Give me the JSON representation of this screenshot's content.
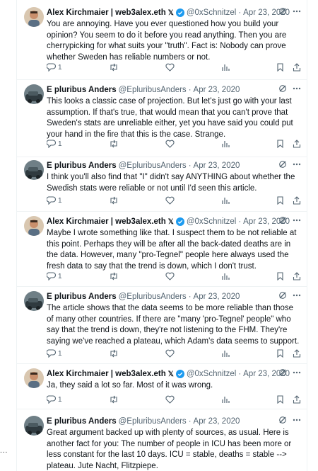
{
  "tweets": [
    {
      "name": "Alex Kirchmaier | web3alex.eth",
      "handle": "@0xSchnitzel",
      "date": "Apr 23, 2020",
      "verified": true,
      "x_badge": "𝕏",
      "avatar": "alex",
      "text": "You are annoying. Have you ever questioned how you build your opinion? You seem to do it before you read anything. Then you are cherrypicking for what suits your \"truth\". Fact is: Nobody can prove whether Sweden has reliable numbers or not.",
      "replies": "1"
    },
    {
      "name": "E pluribus Anders",
      "handle": "@EpluribusAnders",
      "date": "Apr 23, 2020",
      "verified": false,
      "avatar": "anders",
      "text": "This looks a classic case of projection. But let's just go with your last assumption. If that's true, that would mean that you can't prove that Sweden's stats are unreliable either, yet you have said you could put your hand in the fire that this is the case. Strange.",
      "replies": "1"
    },
    {
      "name": "E pluribus Anders",
      "handle": "@EpluribusAnders",
      "date": "Apr 23, 2020",
      "verified": false,
      "avatar": "anders",
      "text": "I think you'll also find that \"I\" didn't say ANYTHING about whether the Swedish stats were reliable or not until I'd seen this article.",
      "replies": "1"
    },
    {
      "name": "Alex Kirchmaier | web3alex.eth",
      "handle": "@0xSchnitzel",
      "date": "Apr 23, 2020",
      "verified": true,
      "x_badge": "𝕏",
      "avatar": "alex",
      "text": "Maybe I wrote something like that. I suspect them to be not reliable at this point. Perhaps they will be after all the back-dated deaths are in the data. However, many \"pro-Tegnel\" people here always used the fresh data to say that the trend is down, which I don't trust.",
      "replies": "1"
    },
    {
      "name": "E pluribus Anders",
      "handle": "@EpluribusAnders",
      "date": "Apr 23, 2020",
      "verified": false,
      "avatar": "anders",
      "text": "The article shows that the data seems to be more reliable than those of many other countries. If there are \"many 'pro-Tegnel' people\" who say that the trend is down, they're not listening to the FHM. They're saying we've reached a plateau, which Adam's data seems to support.",
      "replies": "1"
    },
    {
      "name": "Alex Kirchmaier | web3alex.eth",
      "handle": "@0xSchnitzel",
      "date": "Apr 23, 2020",
      "verified": true,
      "x_badge": "𝕏",
      "avatar": "alex",
      "text": "Ja, they said a lot so far. Most of it was wrong.",
      "replies": "1"
    },
    {
      "name": "E pluribus Anders",
      "handle": "@EpluribusAnders",
      "date": "Apr 23, 2020",
      "verified": false,
      "avatar": "anders",
      "text": "Great argument backed up with plenty of sources, as usual. Here is another fact for you: The number of people in ICU has been more or less constant for the last 10 days. ICU = stable, deaths = stable --> plateau. Jute Nacht, Flitzpiepe.",
      "replies": ""
    }
  ],
  "side_dots": "..."
}
